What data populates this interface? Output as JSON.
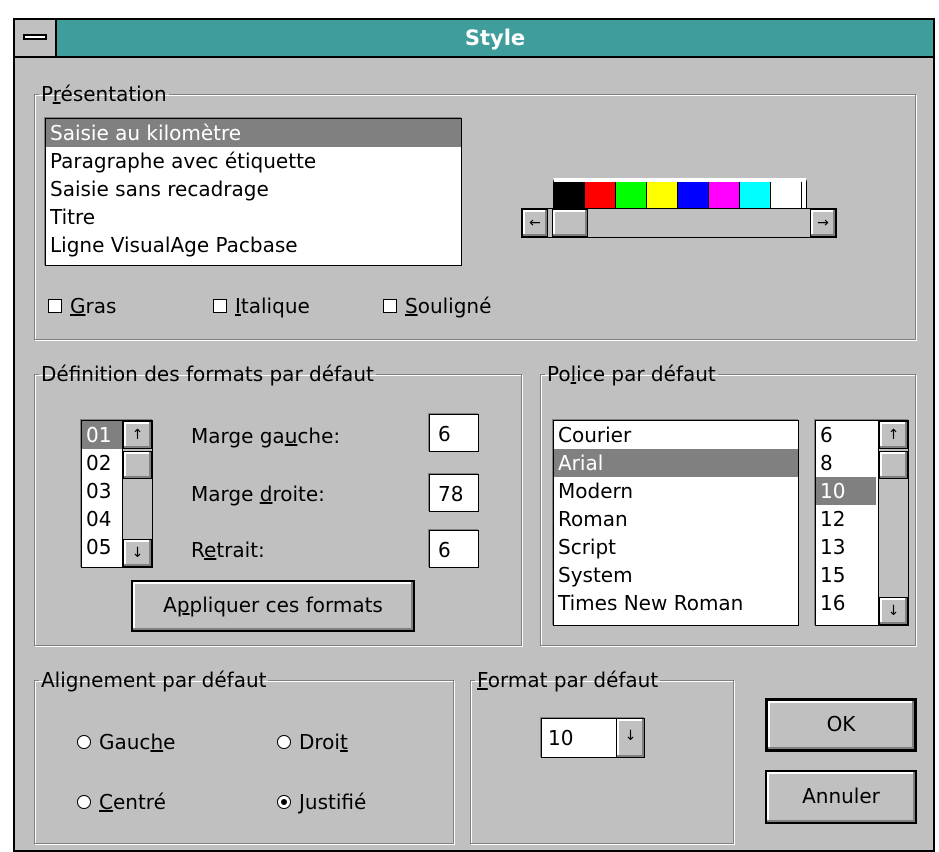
{
  "window": {
    "title": "Style"
  },
  "presentation": {
    "legend_pre": "P",
    "legend_ul": "r",
    "legend_post": "ésentation",
    "items": [
      {
        "label": "Saisie au kilomètre",
        "selected": true
      },
      {
        "label": "Paragraphe avec étiquette"
      },
      {
        "label": "Saisie sans recadrage"
      },
      {
        "label": "Titre"
      },
      {
        "label": "Ligne VisualAge Pacbase"
      }
    ],
    "palette": [
      "#000000",
      "#ff0000",
      "#00ff00",
      "#ffff00",
      "#0000ff",
      "#ff00ff",
      "#00ffff",
      "#ffffff"
    ],
    "scroll_left": "←",
    "scroll_right": "→",
    "checkboxes": {
      "gras": {
        "ul": "G",
        "rest": "ras",
        "checked": false
      },
      "italique": {
        "ul": "I",
        "rest": "talique",
        "checked": false
      },
      "souligne": {
        "ul": "S",
        "rest": "ouligné",
        "checked": false
      }
    }
  },
  "formats": {
    "legend": "Définition des formats par défaut",
    "levels": [
      {
        "label": "01",
        "selected": true
      },
      {
        "label": "02"
      },
      {
        "label": "03"
      },
      {
        "label": "04"
      },
      {
        "label": "05"
      }
    ],
    "marge_gauche": {
      "pre": "Marge ga",
      "ul": "u",
      "post": "che:",
      "value": "6"
    },
    "marge_droite": {
      "pre": "Marge ",
      "ul": "d",
      "post": "roite:",
      "value": "78"
    },
    "retrait": {
      "pre": "R",
      "ul": "e",
      "post": "trait:",
      "value": "6"
    },
    "apply_button": {
      "pre": "A",
      "ul": "p",
      "post": "pliquer ces formats"
    }
  },
  "police": {
    "legend_pre": "Po",
    "legend_ul": "l",
    "legend_post": "ice par défaut",
    "fonts": [
      {
        "label": "Courier"
      },
      {
        "label": "Arial",
        "selected": true
      },
      {
        "label": "Modern"
      },
      {
        "label": "Roman"
      },
      {
        "label": "Script"
      },
      {
        "label": "System"
      },
      {
        "label": "Times New Roman"
      }
    ],
    "sizes": [
      {
        "label": "6"
      },
      {
        "label": "8"
      },
      {
        "label": "10",
        "selected": true
      },
      {
        "label": "12"
      },
      {
        "label": "13"
      },
      {
        "label": "15"
      },
      {
        "label": "16"
      }
    ]
  },
  "alignement": {
    "legend": "Alignement par défaut",
    "options": {
      "gauche": {
        "pre": "Gauc",
        "ul": "h",
        "post": "e",
        "checked": false
      },
      "droit": {
        "pre": "Droi",
        "ul": "t",
        "post": "",
        "checked": false
      },
      "centre": {
        "pre": "",
        "ul": "C",
        "post": "entré",
        "checked": false
      },
      "justifie": {
        "pre": "",
        "ul": "J",
        "post": "ustifié",
        "checked": true
      }
    }
  },
  "format_defaut": {
    "legend_pre": "",
    "legend_ul": "F",
    "legend_post": "ormat par défaut",
    "value": "10",
    "arrow": "↓"
  },
  "buttons": {
    "ok": "OK",
    "annuler": "Annuler"
  },
  "icons": {
    "up": "↑",
    "down": "↓"
  }
}
